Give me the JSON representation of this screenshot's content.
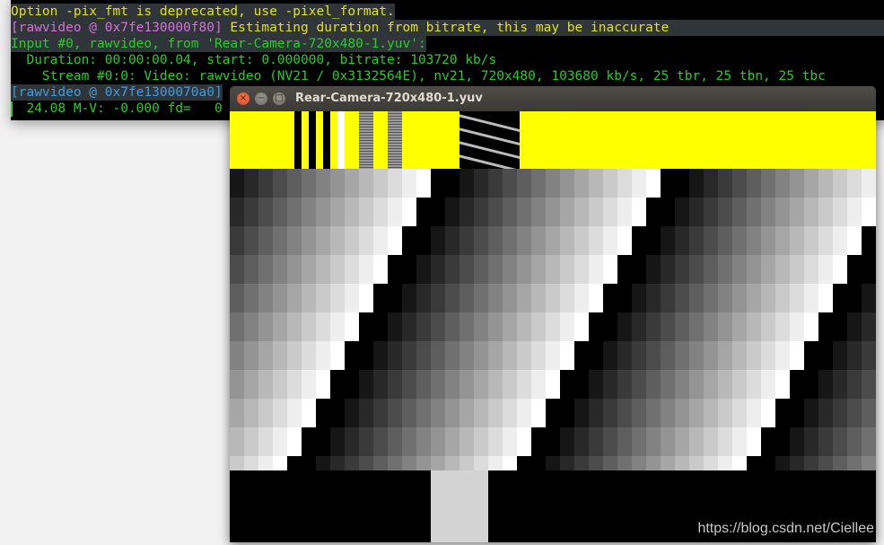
{
  "terminal": {
    "lines": [
      {
        "text": "Option -pix_fmt is deprecated, use -pixel_format.",
        "color": "yellow"
      },
      {
        "prefix": "[rawvideo @ 0x7fe130000f80]",
        "text": " Estimating duration from bitrate, this may be inaccurate"
      },
      {
        "text": "Input #0, rawvideo, from 'Rear-Camera-720x480-1.yuv':"
      },
      {
        "text": "  Duration: 00:00:00.04, start: 0.000000, bitrate: 103720 kb/s"
      },
      {
        "text": "    Stream #0:0: Video: rawvideo (NV21 / 0x3132564E), nv21, 720x480, 103680 kb/s, 25 tbr, 25 tbn, 25 tbc"
      },
      {
        "prefix": "[rawvideo @ 0x7fe1300070a0]"
      },
      {
        "text": "  24.08 M-V: -0.000 fd=   0"
      }
    ],
    "colors": {
      "green": "#22d122",
      "yellow": "#e2e21a",
      "magenta": "#d76fd7",
      "blue": "#3a9de0",
      "background": "#000000",
      "highlight": "#30353a"
    }
  },
  "video_window": {
    "title": "Rear-Camera-720x480-1.yuv",
    "buttons": {
      "close": "×",
      "minimize": "−",
      "maximize": "□"
    },
    "watermark": "https://blog.csdn.net/Ciellee",
    "colors": {
      "band": "#ffff00",
      "block": "#d3d3d3"
    }
  }
}
